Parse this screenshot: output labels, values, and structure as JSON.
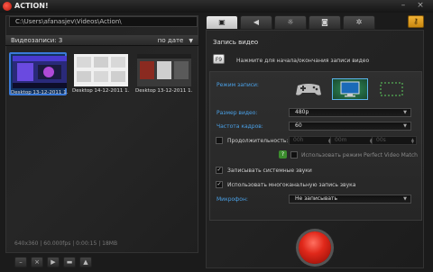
{
  "window": {
    "title": "ACTION!",
    "minimize": "–",
    "close": "×"
  },
  "left": {
    "path": "C:\\Users\\afanasjev\\Videos\\Action\\",
    "records_label": "Видеозаписи: 3",
    "sort_label": "по дате",
    "thumbnails": [
      {
        "caption": "Desktop 13-12-2011 1...",
        "selected": true
      },
      {
        "caption": "Desktop 14-12-2011 1...",
        "selected": false
      },
      {
        "caption": "Desktop 13-12-2011 1...",
        "selected": false
      }
    ],
    "status": "640x360 | 60.000fps | 0:00:15 | 18MB"
  },
  "bottom_buttons": [
    "minus-icon",
    "close-icon",
    "play-icon",
    "folder-icon",
    "upload-icon"
  ],
  "tabs": [
    {
      "name": "video",
      "icon": "video-icon",
      "glyph": "▣",
      "active": true
    },
    {
      "name": "audio",
      "icon": "speaker-icon",
      "glyph": "◀",
      "active": false
    },
    {
      "name": "stream",
      "icon": "stream-icon",
      "glyph": "☼",
      "active": false
    },
    {
      "name": "screenshot",
      "icon": "camera-icon",
      "glyph": "◙",
      "active": false
    },
    {
      "name": "settings",
      "icon": "gear-icon",
      "glyph": "✲",
      "active": false
    }
  ],
  "key_button_glyph": "⚷",
  "video": {
    "section_title": "Запись видео",
    "hotkey": "F9",
    "hotkey_hint": "Нажмите для начала/окончания записи видео",
    "mode_label": "Режим записи:",
    "size_label": "Размер видео:",
    "size_value": "480p",
    "fps_label": "Частота кадров:",
    "fps_value": "60",
    "duration_label": "Продолжительность:",
    "duration_h": "00h",
    "duration_m": "00m",
    "duration_s": "00s",
    "pvm_label": "Использовать режим Perfect Video Match",
    "system_sounds_label": "Записывать системные звуки",
    "multichannel_label": "Использовать многоканальную запись звука",
    "mic_label": "Микрофон:",
    "mic_value": "Не записывать",
    "help_glyph": "?",
    "check_glyph": "✓"
  },
  "colors": {
    "accent": "#4aa0e6",
    "record": "#e0281a",
    "active_mode_border": "#5ab3ea",
    "key_button": "#f1b235"
  }
}
